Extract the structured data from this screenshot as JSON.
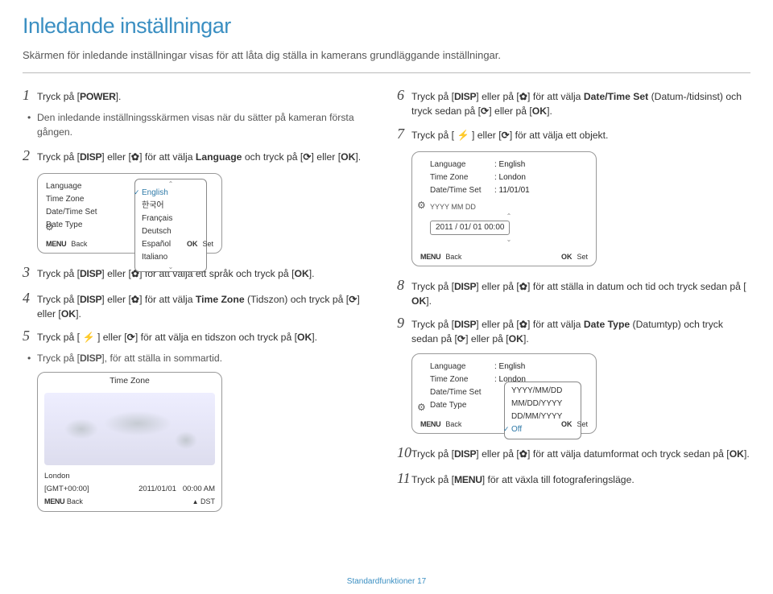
{
  "header": {
    "title": "Inledande inställningar",
    "subtitle": "Skärmen för inledande inställningar visas för att låta dig ställa in kamerans grundläggande inställningar."
  },
  "left": {
    "s1_pre": "Tryck på [",
    "s1_post": "].",
    "s1_bullet": "Den inledande inställningsskärmen visas när du sätter på kameran första gången.",
    "s2_a": "Tryck på [",
    "s2_b": "] eller [",
    "s2_c": "] för att välja ",
    "s2_lang": "Language",
    "s2_d": " och tryck på [",
    "s2_e": "] eller [",
    "s2_f": "].",
    "panel1": {
      "rows": [
        {
          "label": "Language",
          "val": ""
        },
        {
          "label": "Time Zone",
          "val": ""
        },
        {
          "label": "Date/Time Set",
          "val": ""
        },
        {
          "label": "Date Type",
          "val": ""
        }
      ],
      "popup": [
        "English",
        "한국어",
        "Français",
        "Deutsch",
        "Español",
        "Italiano"
      ],
      "footer": {
        "back": "Back",
        "set": "Set"
      }
    },
    "s3_a": "Tryck på [",
    "s3_b": "] eller [",
    "s3_c": "] för att välja ett språk och tryck på [",
    "s3_d": "].",
    "s4_a": "Tryck på [",
    "s4_b": "] eller [",
    "s4_c": "] för att välja ",
    "s4_tz": "Time Zone",
    "s4_d": " (Tidszon) och tryck på [",
    "s4_e": "] eller [",
    "s4_f": "].",
    "s5_a": "Tryck på [ ",
    "s5_b": " ] eller [",
    "s5_c": "] för att välja en tidszon och tryck på [",
    "s5_d": "].",
    "s5_bullet_a": "Tryck på [",
    "s5_bullet_b": "], för att ställa in sommartid.",
    "panelWorld": {
      "title": "Time Zone",
      "city": "London",
      "gmt": "[GMT+00:00]",
      "date": "2011/01/01",
      "time": "00:00 AM",
      "back": "Back",
      "dst": "DST"
    }
  },
  "right": {
    "s6_a": "Tryck på [",
    "s6_b": "] eller på [",
    "s6_c": "] för att välja ",
    "s6_dt": "Date/Time Set",
    "s6_d": " (Datum-/tidsinst) och tryck sedan på [",
    "s6_e": "] eller på [",
    "s6_f": "].",
    "s7_a": "Tryck på [ ",
    "s7_b": " ] eller [",
    "s7_c": "] för att välja ett objekt.",
    "panel2": {
      "rows": [
        {
          "label": "Language",
          "val": ": English"
        },
        {
          "label": "Time Zone",
          "val": ": London"
        },
        {
          "label": "Date/Time Set",
          "val": ": 11/01/01"
        }
      ],
      "yyyy": "YYYY MM DD",
      "sel": "2011 / 01/ 01  00:00",
      "footer": {
        "back": "Back",
        "set": "Set"
      }
    },
    "s8_a": "Tryck på [",
    "s8_b": "] eller på [",
    "s8_c": "] för att ställa in datum och tid och tryck sedan på [",
    "s8_d": "].",
    "s9_a": "Tryck på [",
    "s9_b": "] eller på [",
    "s9_c": "] för att välja ",
    "s9_dtype": "Date Type",
    "s9_d": " (Datumtyp) och tryck sedan på [",
    "s9_e": "] eller på [",
    "s9_f": "].",
    "panel3": {
      "rows": [
        {
          "label": "Language",
          "val": ": English"
        },
        {
          "label": "Time Zone",
          "val": ": London"
        },
        {
          "label": "Date/Time Set",
          "val": ""
        },
        {
          "label": "Date Type",
          "val": ""
        }
      ],
      "popup": [
        "YYYY/MM/DD",
        "MM/DD/YYYY",
        "DD/MM/YYYY",
        "Off"
      ],
      "footer": {
        "back": "Back",
        "set": "Set"
      }
    },
    "s10_a": "Tryck på [",
    "s10_b": "] eller på [",
    "s10_c": "] för att välja datumformat och tryck sedan på [",
    "s10_d": "].",
    "s11_a": "Tryck på [",
    "s11_b": "] för att växla till fotograferingsläge."
  },
  "footer": {
    "section": "Standardfunktioner",
    "page": "17"
  }
}
